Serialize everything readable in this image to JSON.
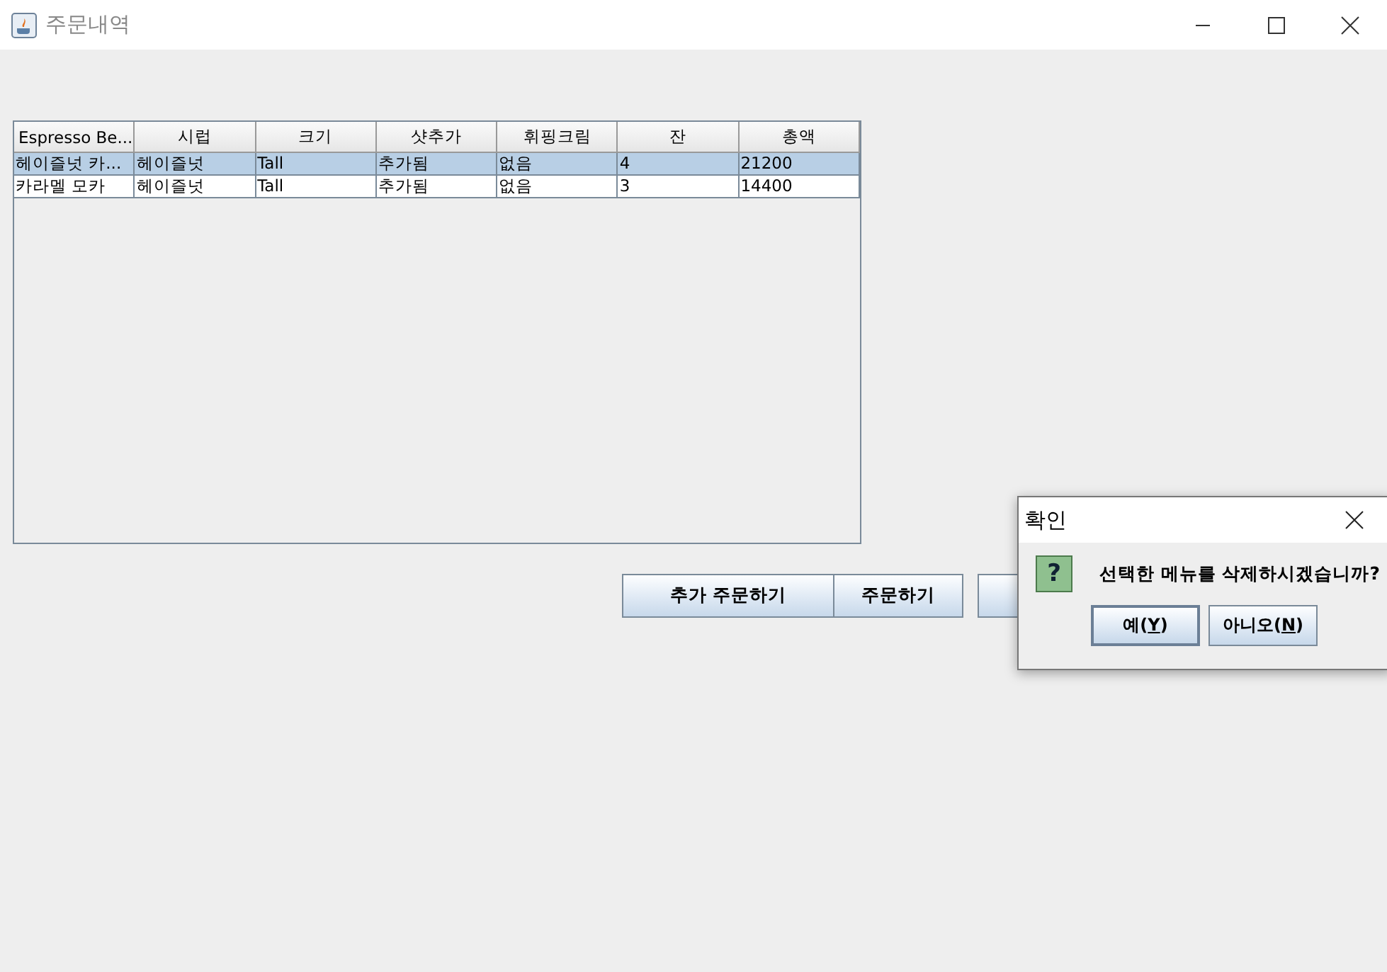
{
  "window": {
    "title": "주문내역"
  },
  "table": {
    "columns": [
      "Espresso Be...",
      "시럽",
      "크기",
      "샷추가",
      "휘핑크림",
      "잔",
      "총액"
    ],
    "rows": [
      {
        "selected": true,
        "cells": [
          "헤이즐넛 카...",
          "헤이즐넛",
          "Tall",
          "추가됨",
          "없음",
          "4",
          "21200"
        ]
      },
      {
        "selected": false,
        "cells": [
          "카라멜 모카",
          "헤이즐넛",
          "Tall",
          "추가됨",
          "없음",
          "3",
          "14400"
        ]
      }
    ]
  },
  "buttons": [
    {
      "label": "추가 주문하기"
    },
    {
      "label": "주문하기"
    },
    {
      "kind": "covered"
    }
  ],
  "dialog": {
    "title": "확인",
    "message": "선택한 메뉴를 삭제하시겠습니까?",
    "icon": "?",
    "buttons": [
      {
        "before": "예(",
        "mnemonic": "Y",
        "after": ")",
        "focused": true
      },
      {
        "before": "아니오(",
        "mnemonic": "N",
        "after": ")",
        "focused": false
      }
    ]
  }
}
